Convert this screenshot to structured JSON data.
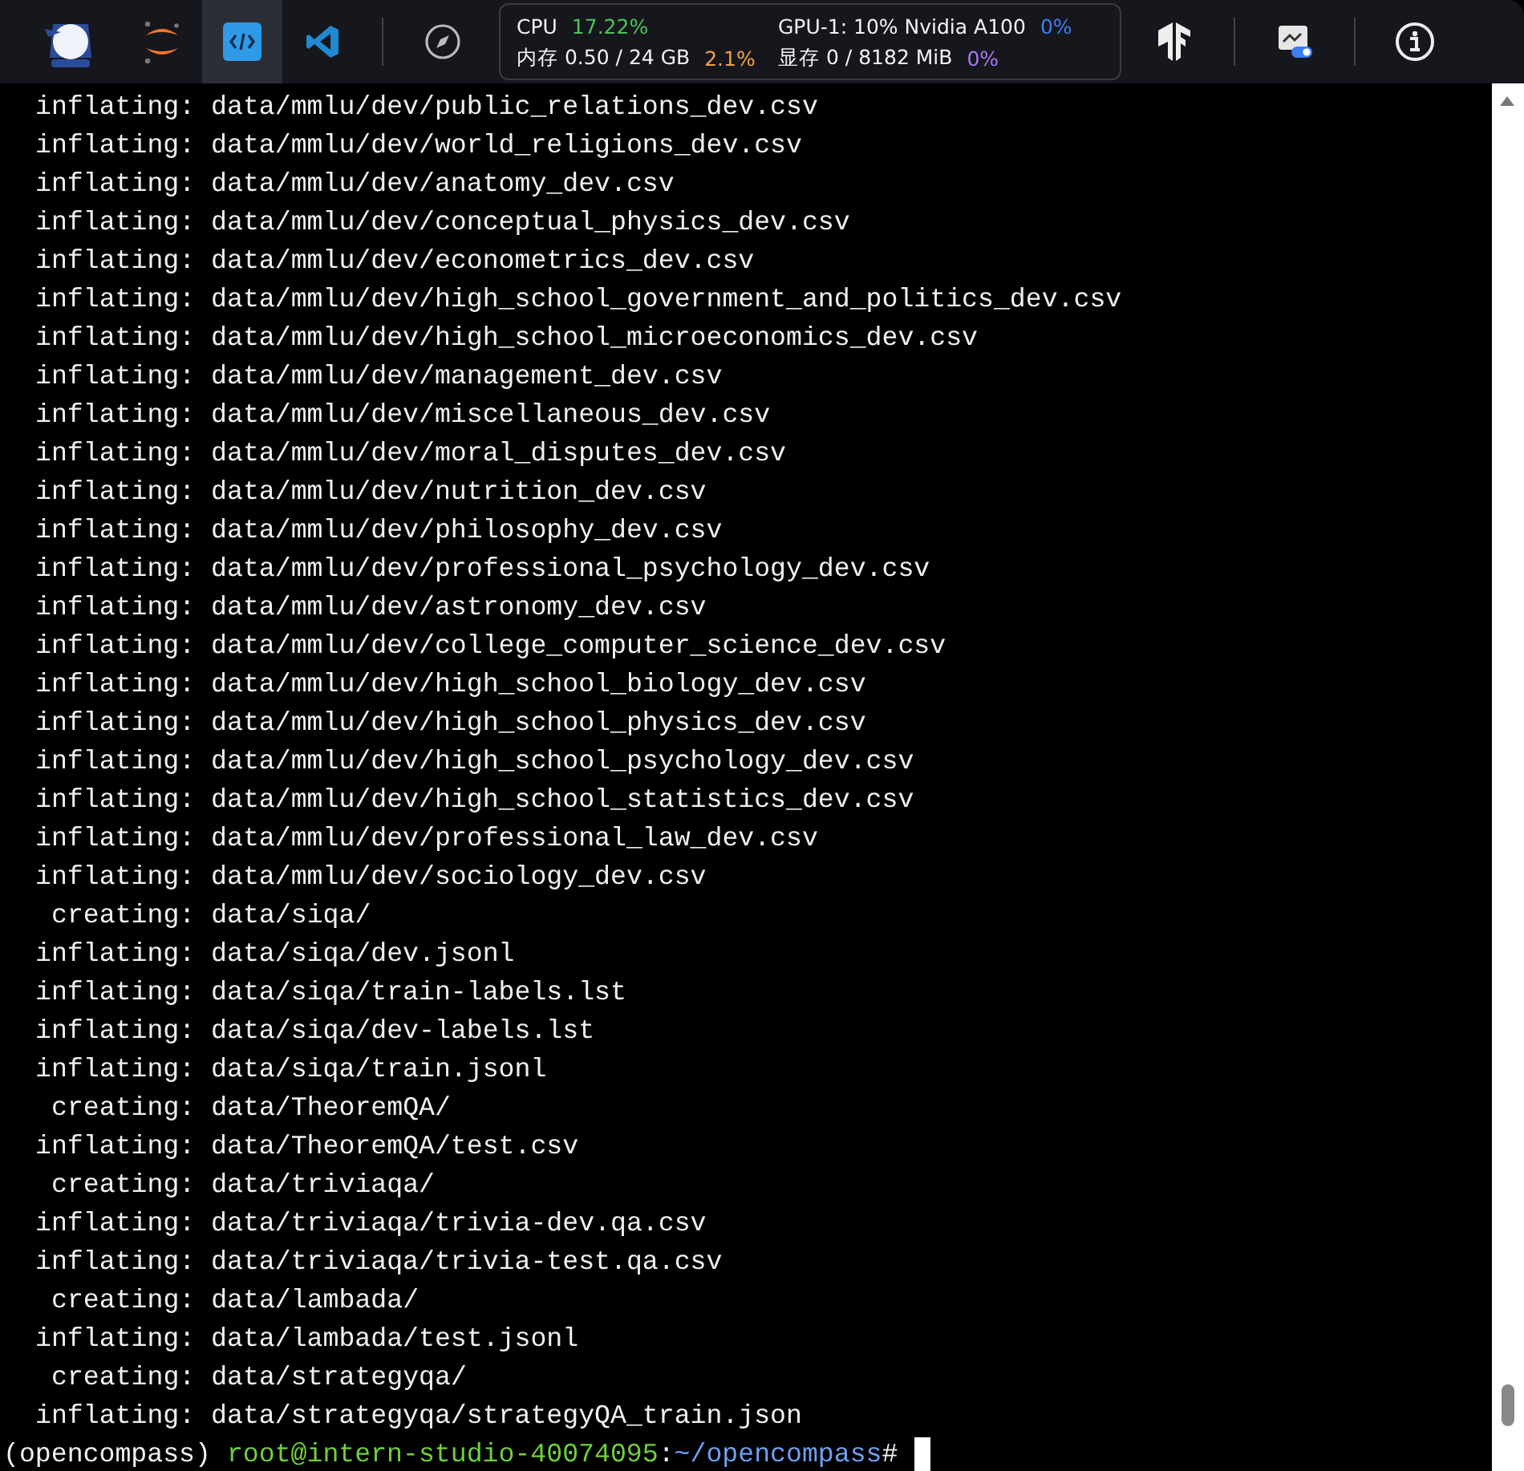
{
  "toolbar": {
    "items": [
      {
        "kind": "logo",
        "selected": false
      },
      {
        "kind": "jupyter",
        "selected": false
      },
      {
        "kind": "code",
        "selected": true
      },
      {
        "kind": "vscode",
        "selected": false
      },
      {
        "kind": "compass",
        "selected": false
      }
    ],
    "stats": [
      {
        "label": "CPU",
        "percent": "17.22%",
        "color": "#4cc35a"
      },
      {
        "label": "内存 0.50 / 24 GB",
        "percent": "2.1%",
        "color": "#f0a04b"
      },
      {
        "label": "GPU-1: 10% Nvidia A100",
        "percent": "0%",
        "color": "#3d7ef5"
      },
      {
        "label": "显存 0 / 8182 MiB",
        "percent": "0%",
        "color": "#a877f5"
      }
    ],
    "right_items": [
      {
        "kind": "tensorflow"
      },
      {
        "kind": "divider"
      },
      {
        "kind": "monitor"
      },
      {
        "kind": "divider"
      },
      {
        "kind": "info"
      }
    ]
  },
  "terminal": {
    "lines": [
      {
        "kind": "inflating",
        "text": "inflating: data/mmlu/dev/public_relations_dev.csv"
      },
      {
        "kind": "inflating",
        "text": "inflating: data/mmlu/dev/world_religions_dev.csv"
      },
      {
        "kind": "inflating",
        "text": "inflating: data/mmlu/dev/anatomy_dev.csv"
      },
      {
        "kind": "inflating",
        "text": "inflating: data/mmlu/dev/conceptual_physics_dev.csv"
      },
      {
        "kind": "inflating",
        "text": "inflating: data/mmlu/dev/econometrics_dev.csv"
      },
      {
        "kind": "inflating",
        "text": "inflating: data/mmlu/dev/high_school_government_and_politics_dev.csv"
      },
      {
        "kind": "inflating",
        "text": "inflating: data/mmlu/dev/high_school_microeconomics_dev.csv"
      },
      {
        "kind": "inflating",
        "text": "inflating: data/mmlu/dev/management_dev.csv"
      },
      {
        "kind": "inflating",
        "text": "inflating: data/mmlu/dev/miscellaneous_dev.csv"
      },
      {
        "kind": "inflating",
        "text": "inflating: data/mmlu/dev/moral_disputes_dev.csv"
      },
      {
        "kind": "inflating",
        "text": "inflating: data/mmlu/dev/nutrition_dev.csv"
      },
      {
        "kind": "inflating",
        "text": "inflating: data/mmlu/dev/philosophy_dev.csv"
      },
      {
        "kind": "inflating",
        "text": "inflating: data/mmlu/dev/professional_psychology_dev.csv"
      },
      {
        "kind": "inflating",
        "text": "inflating: data/mmlu/dev/astronomy_dev.csv"
      },
      {
        "kind": "inflating",
        "text": "inflating: data/mmlu/dev/college_computer_science_dev.csv"
      },
      {
        "kind": "inflating",
        "text": "inflating: data/mmlu/dev/high_school_biology_dev.csv"
      },
      {
        "kind": "inflating",
        "text": "inflating: data/mmlu/dev/high_school_physics_dev.csv"
      },
      {
        "kind": "inflating",
        "text": "inflating: data/mmlu/dev/high_school_psychology_dev.csv"
      },
      {
        "kind": "inflating",
        "text": "inflating: data/mmlu/dev/high_school_statistics_dev.csv"
      },
      {
        "kind": "inflating",
        "text": "inflating: data/mmlu/dev/professional_law_dev.csv"
      },
      {
        "kind": "inflating",
        "text": "inflating: data/mmlu/dev/sociology_dev.csv"
      },
      {
        "kind": "creating",
        "text": "creating: data/siqa/"
      },
      {
        "kind": "inflating",
        "text": "inflating: data/siqa/dev.jsonl"
      },
      {
        "kind": "inflating",
        "text": "inflating: data/siqa/train-labels.lst"
      },
      {
        "kind": "inflating",
        "text": "inflating: data/siqa/dev-labels.lst"
      },
      {
        "kind": "inflating",
        "text": "inflating: data/siqa/train.jsonl"
      },
      {
        "kind": "creating",
        "text": "creating: data/TheoremQA/"
      },
      {
        "kind": "inflating",
        "text": "inflating: data/TheoremQA/test.csv"
      },
      {
        "kind": "creating",
        "text": "creating: data/triviaqa/"
      },
      {
        "kind": "inflating",
        "text": "inflating: data/triviaqa/trivia-dev.qa.csv"
      },
      {
        "kind": "inflating",
        "text": "inflating: data/triviaqa/trivia-test.qa.csv"
      },
      {
        "kind": "creating",
        "text": "creating: data/lambada/"
      },
      {
        "kind": "inflating",
        "text": "inflating: data/lambada/test.jsonl"
      },
      {
        "kind": "creating",
        "text": "creating: data/strategyqa/"
      },
      {
        "kind": "inflating",
        "text": "inflating: data/strategyqa/strategyQA_train.json"
      }
    ],
    "prompt": {
      "env": "(opencompass)",
      "user_host": "root@intern-studio-40074095",
      "separator": ":",
      "path": "~/opencompass",
      "symbol": "#"
    }
  }
}
